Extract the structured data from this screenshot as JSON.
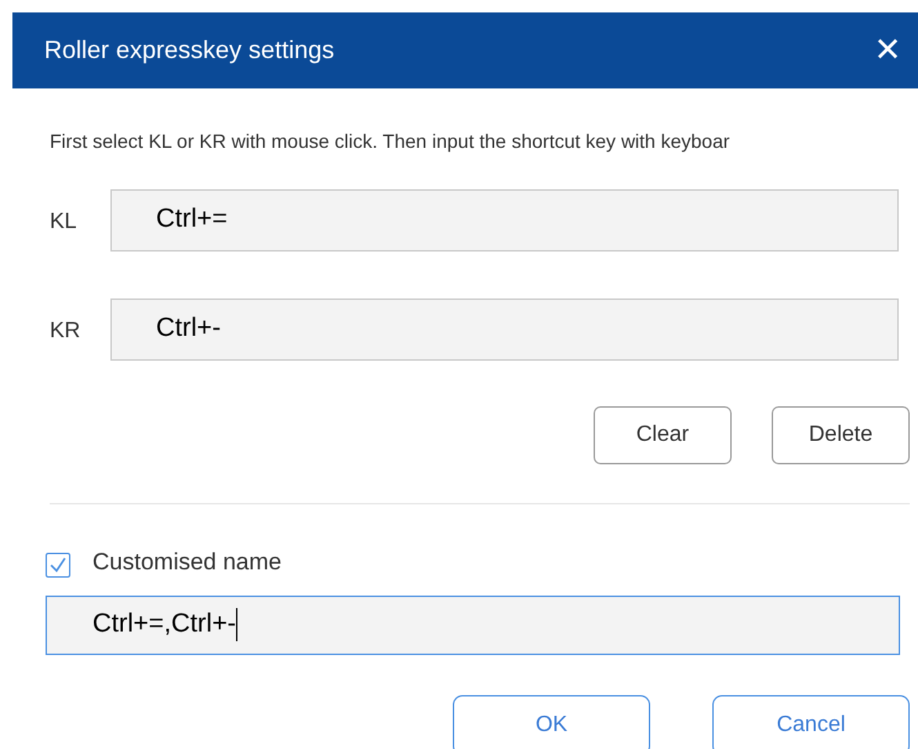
{
  "window": {
    "title": "Roller expresskey settings",
    "close": "✕"
  },
  "instruction": "First select KL or KR with mouse click. Then input the shortcut key with keyboar",
  "keys": [
    {
      "label": "KL",
      "value": "Ctrl+="
    },
    {
      "label": "KR",
      "value": "Ctrl+-"
    }
  ],
  "key_buttons": [
    "Clear",
    "Delete"
  ],
  "custom_name": {
    "label": "Customised name",
    "checked": true,
    "value": "Ctrl+=,Ctrl+-"
  },
  "buttons": [
    "OK",
    "Cancel"
  ]
}
